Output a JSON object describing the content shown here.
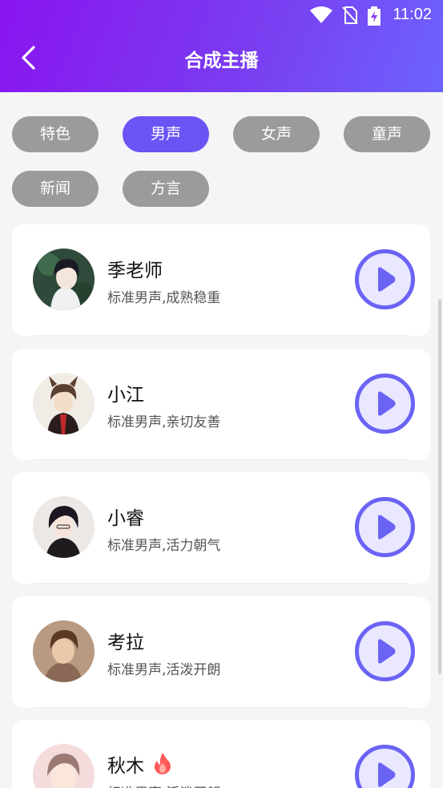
{
  "status_bar": {
    "time": "11:02"
  },
  "header": {
    "title": "合成主播"
  },
  "tabs": [
    "特色",
    "男声",
    "女声",
    "童声",
    "新闻",
    "方言"
  ],
  "active_tab": "男声",
  "voices": [
    {
      "name": "季老师",
      "desc": "标准男声,成熟稳重",
      "hot": false
    },
    {
      "name": "小江",
      "desc": "标准男声,亲切友善",
      "hot": false
    },
    {
      "name": "小睿",
      "desc": "标准男声,活力朝气",
      "hot": false
    },
    {
      "name": "考拉",
      "desc": "标准男声,活泼开朗",
      "hot": false
    },
    {
      "name": "秋木",
      "desc": "标准男声,活泼开朗",
      "hot": true
    }
  ],
  "colors": {
    "accent": "#6b54f4",
    "header_start": "#8a14f0",
    "header_end": "#6c63ff",
    "chip_inactive": "#9b9b9b"
  },
  "icons": {
    "back": "chevron-left-icon",
    "play": "play-icon",
    "hot": "fire-icon"
  }
}
